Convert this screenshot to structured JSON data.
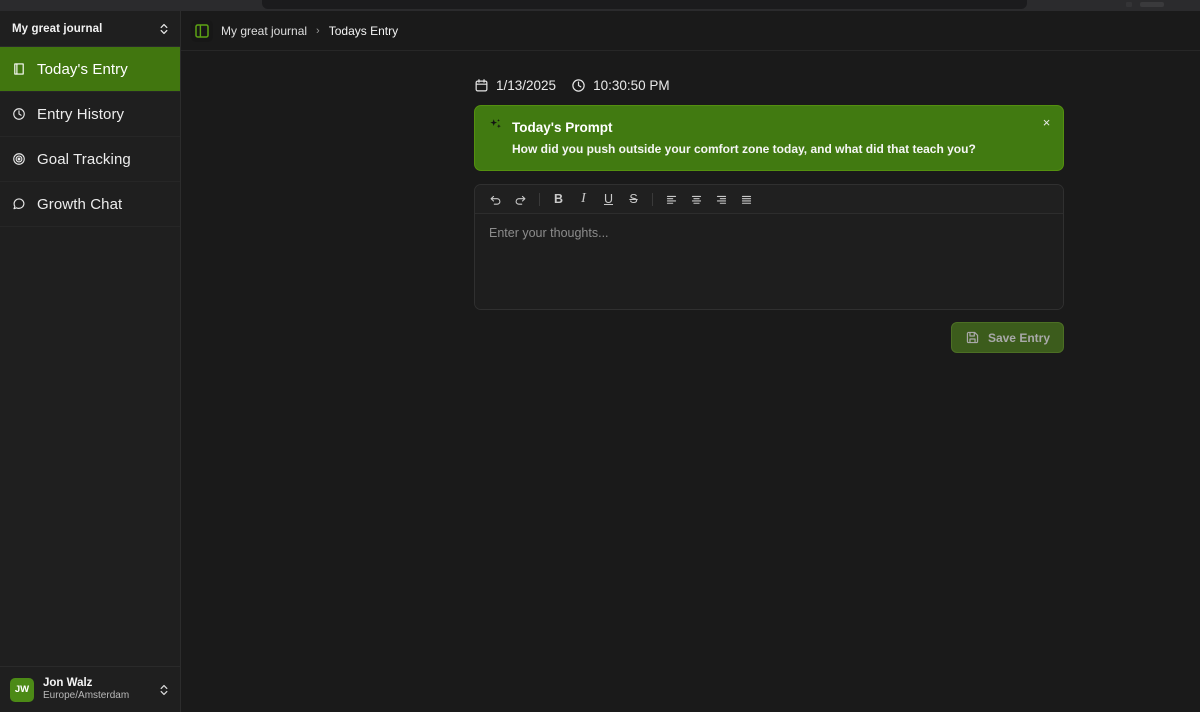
{
  "browser": {
    "chrome_visible": true
  },
  "colors": {
    "accent_green": "#41760f",
    "banner_green": "#417a11",
    "avatar_green": "#4c8a16",
    "sidebar_bg": "#1f1f1f",
    "main_bg": "#1a1a1a",
    "save_btn_bg": "#3c5c1c"
  },
  "sidebar": {
    "journal_name": "My great journal",
    "selector_icon": "chevrons-up-down-icon",
    "items": [
      {
        "label": "Today's Entry",
        "icon": "book-icon",
        "active": true
      },
      {
        "label": "Entry History",
        "icon": "clock-icon",
        "active": false
      },
      {
        "label": "Goal Tracking",
        "icon": "target-icon",
        "active": false
      },
      {
        "label": "Growth Chat",
        "icon": "message-circle-icon",
        "active": false
      }
    ],
    "user": {
      "initials": "JW",
      "name": "Jon Walz",
      "timezone": "Europe/Amsterdam",
      "menu_icon": "chevrons-up-down-icon"
    }
  },
  "topbar": {
    "panel_toggle_icon": "panel-left-icon",
    "breadcrumb": [
      {
        "label": "My great journal",
        "current": false
      },
      {
        "label": "Todays Entry",
        "current": true
      }
    ],
    "separator": "›"
  },
  "entry": {
    "date": "1/13/2025",
    "date_icon": "calendar-icon",
    "time": "10:30:50 PM",
    "time_icon": "clock-icon",
    "prompt": {
      "icon": "sparkles-icon",
      "title": "Today's Prompt",
      "text": "How did you push outside your comfort zone today, and what did that teach you?",
      "close_icon": "close-icon",
      "close_label": "×"
    },
    "toolbar": [
      {
        "name": "undo-button",
        "icon": "undo-icon",
        "glyph": "↶",
        "type": "icon"
      },
      {
        "name": "redo-button",
        "icon": "redo-icon",
        "glyph": "↷",
        "type": "icon"
      },
      {
        "name": "toolbar-separator-1",
        "icon": "separator",
        "glyph": "",
        "type": "sep"
      },
      {
        "name": "bold-button",
        "icon": "bold-icon",
        "glyph": "B",
        "type": "text"
      },
      {
        "name": "italic-button",
        "icon": "italic-icon",
        "glyph": "I",
        "type": "text"
      },
      {
        "name": "underline-button",
        "icon": "underline-icon",
        "glyph": "U",
        "type": "text"
      },
      {
        "name": "strikethrough-button",
        "icon": "strikethrough-icon",
        "glyph": "S",
        "type": "text"
      },
      {
        "name": "toolbar-separator-2",
        "icon": "separator",
        "glyph": "",
        "type": "sep"
      },
      {
        "name": "align-left-button",
        "icon": "align-left-icon",
        "glyph": "",
        "type": "align"
      },
      {
        "name": "align-center-button",
        "icon": "align-center-icon",
        "glyph": "",
        "type": "align"
      },
      {
        "name": "align-right-button",
        "icon": "align-right-icon",
        "glyph": "",
        "type": "align"
      },
      {
        "name": "align-justify-button",
        "icon": "align-justify-icon",
        "glyph": "",
        "type": "align"
      }
    ],
    "editor": {
      "placeholder": "Enter your thoughts...",
      "value": ""
    },
    "save": {
      "label": "Save Entry",
      "icon": "save-icon"
    }
  }
}
